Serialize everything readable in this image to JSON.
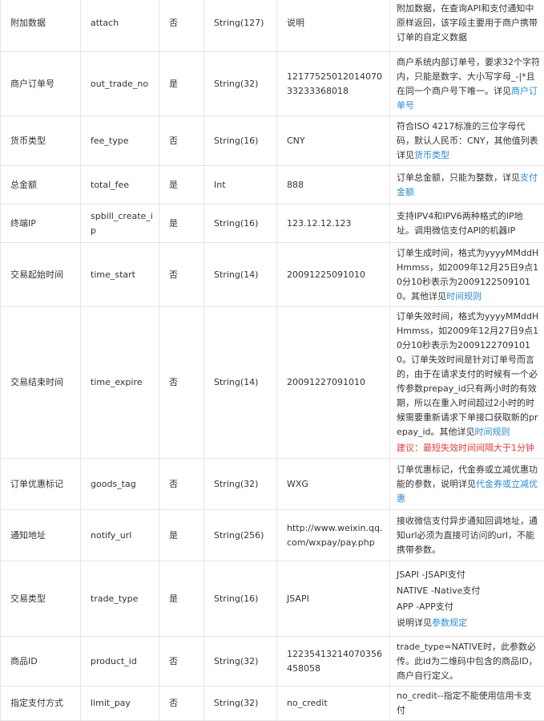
{
  "colors": {
    "link": "#2a8bd5",
    "warning": "#e4393c",
    "border": "#e6e6e6",
    "text": "#333333"
  },
  "rows": [
    {
      "name": "附加数据",
      "field": "attach",
      "required": "否",
      "type": "String(127)",
      "sample": "说明",
      "desc": {
        "text": "附加数据，在查询API和支付通知中原样返回，该字段主要用于商户携带订单的自定义数据"
      }
    },
    {
      "name": "商户订单号",
      "field": "out_trade_no",
      "required": "是",
      "type": "String(32)",
      "sample": "1217752501201407033233368018",
      "desc": {
        "text": "商户系统内部订单号，要求32个字符内，只能是数字、大小写字母_-|*且在同一个商户号下唯一。详见",
        "link": "商户订单号"
      }
    },
    {
      "name": "货币类型",
      "field": "fee_type",
      "required": "否",
      "type": "String(16)",
      "sample": "CNY",
      "desc": {
        "text": "符合ISO 4217标准的三位字母代码，默认人民币：CNY，其他值列表详见",
        "link": "货币类型"
      }
    },
    {
      "name": "总金额",
      "field": "total_fee",
      "required": "是",
      "type": "Int",
      "sample": "888",
      "desc": {
        "text": "订单总金额，只能为整数，详见",
        "link": "支付金额"
      }
    },
    {
      "name": "终端IP",
      "field": "spbill_create_ip",
      "required": "是",
      "type": "String(16)",
      "sample": "123.12.12.123",
      "desc": {
        "text": "支持IPV4和IPV6两种格式的IP地址。调用微信支付API的机器IP"
      }
    },
    {
      "name": "交易起始时间",
      "field": "time_start",
      "required": "否",
      "type": "String(14)",
      "sample": "20091225091010",
      "desc": {
        "text": "订单生成时间，格式为yyyyMMddHHmmss，如2009年12月25日9点10分10秒表示为20091225091010。其他详见",
        "link": "时间规则"
      }
    },
    {
      "name": "交易结束时间",
      "field": "time_expire",
      "required": "否",
      "type": "String(14)",
      "sample": "20091227091010",
      "desc": {
        "text": "订单失效时间，格式为yyyyMMddHHmmss，如2009年12月27日9点10分10秒表示为20091227091010。订单失效时间是针对订单号而言的，由于在请求支付的时候有一个必传参数prepay_id只有两小时的有效期，所以在重入时间超过2小时的时候需要重新请求下单接口获取新的prepay_id。其他详见",
        "link": "时间规则",
        "warning": "建议：最短失效时间间隔大于1分钟"
      }
    },
    {
      "name": "订单优惠标记",
      "field": "goods_tag",
      "required": "否",
      "type": "String(32)",
      "sample": "WXG",
      "desc": {
        "text": "订单优惠标记，代金券或立减优惠功能的参数，说明详见",
        "link": "代金券或立减优惠"
      }
    },
    {
      "name": "通知地址",
      "field": "notify_url",
      "required": "是",
      "type": "String(256)",
      "sample": "http://www.weixin.qq.com/wxpay/pay.php",
      "desc": {
        "text": "接收微信支付异步通知回调地址，通知url必须为直接可访问的url，不能携带参数。"
      }
    },
    {
      "name": "交易类型",
      "field": "trade_type",
      "required": "是",
      "type": "String(16)",
      "sample": "JSAPI",
      "desc": {
        "lines": [
          "JSAPI -JSAPI支付",
          "NATIVE -Native支付",
          "APP -APP支付"
        ],
        "text": "说明详见",
        "link": "参数规定"
      }
    },
    {
      "name": "商品ID",
      "field": "product_id",
      "required": "否",
      "type": "String(32)",
      "sample": "12235413214070356458058",
      "desc": {
        "text": "trade_type=NATIVE时，此参数必传。此id为二维码中包含的商品ID，商户自行定义。"
      }
    },
    {
      "name": "指定支付方式",
      "field": "limit_pay",
      "required": "否",
      "type": "String(32)",
      "sample": "no_credit",
      "desc": {
        "text": "no_credit--指定不能使用信用卡支付"
      }
    }
  ]
}
